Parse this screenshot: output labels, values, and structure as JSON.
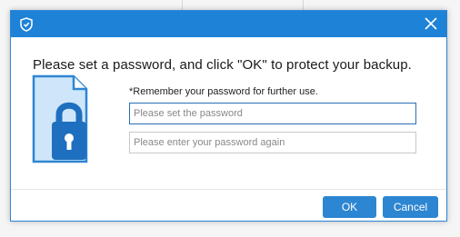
{
  "dialog": {
    "headline": "Please set a password, and click \"OK\" to protect your backup.",
    "hint": "*Remember your password for further use.",
    "password_placeholder": "Please set the password",
    "confirm_placeholder": "Please enter your password again",
    "ok_label": "OK",
    "cancel_label": "Cancel"
  },
  "icons": {
    "app": "shield-icon",
    "close": "close-icon",
    "illustration": "document-lock-icon"
  },
  "colors": {
    "accent": "#1e82d7",
    "button": "#2d86d2",
    "focused_border": "#2a6fb5"
  }
}
